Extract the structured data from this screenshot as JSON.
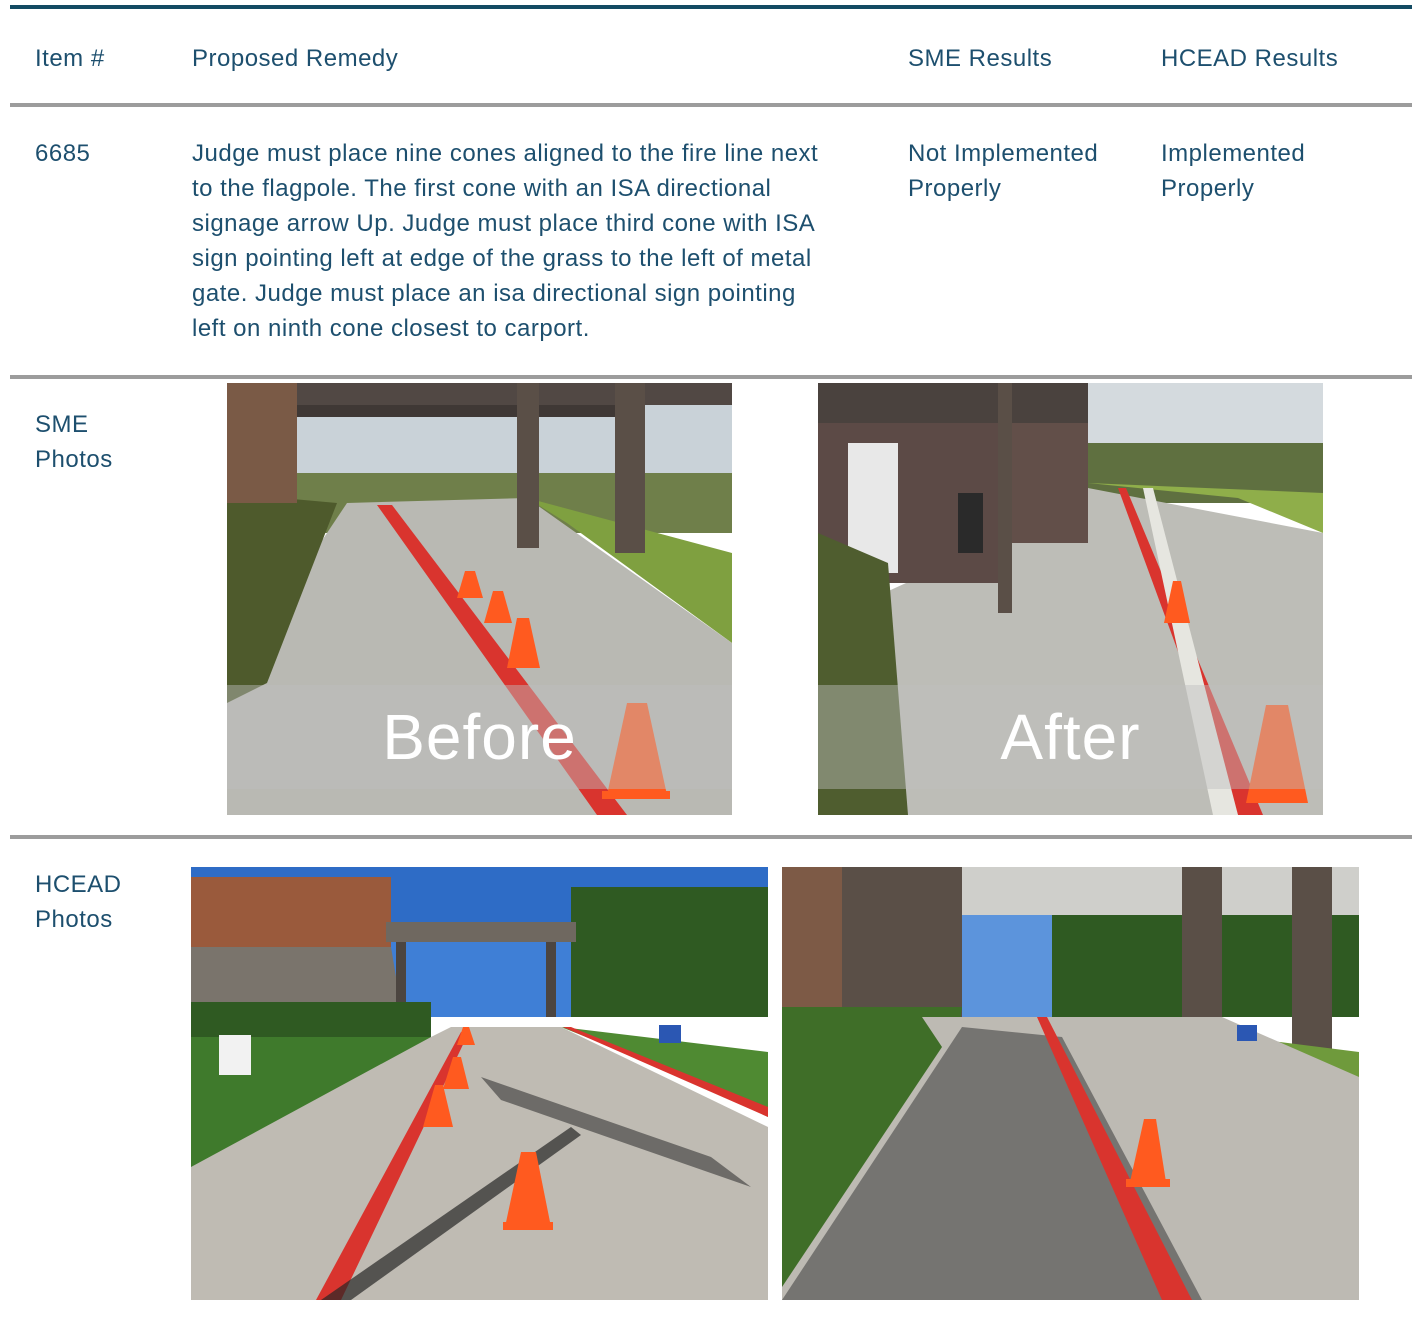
{
  "table": {
    "headers": {
      "item": "Item #",
      "remedy": "Proposed Remedy",
      "sme": "SME Results",
      "hcead": "HCEAD Results"
    },
    "row": {
      "item": "6685",
      "remedy_lines": [
        "Judge must place nine cones aligned to the fire line next",
        "to the flagpole. The first cone with an ISA directional",
        "signage arrow Up.  Judge must place third cone with ISA",
        "sign pointing left at edge of the grass to the left of metal",
        "gate. Judge must place an isa directional sign pointing",
        "left on ninth cone closest to carport."
      ],
      "sme_result_lines": [
        "Not Implemented",
        "Properly"
      ],
      "hcead_result_lines": [
        "Implemented",
        "Properly"
      ]
    }
  },
  "sme_photos": {
    "label_lines": [
      "SME",
      "Photos"
    ],
    "before_overlay": "Before",
    "after_overlay": "After"
  },
  "hcead_photos": {
    "label_lines": [
      "HCEAD",
      "Photos"
    ]
  },
  "colors": {
    "text": "#1d4f6e",
    "top_rule": "#134b63",
    "row_rule": "#9c9c9c",
    "curb_red": "#e0312b",
    "cone_orange": "#ff5a1f"
  }
}
